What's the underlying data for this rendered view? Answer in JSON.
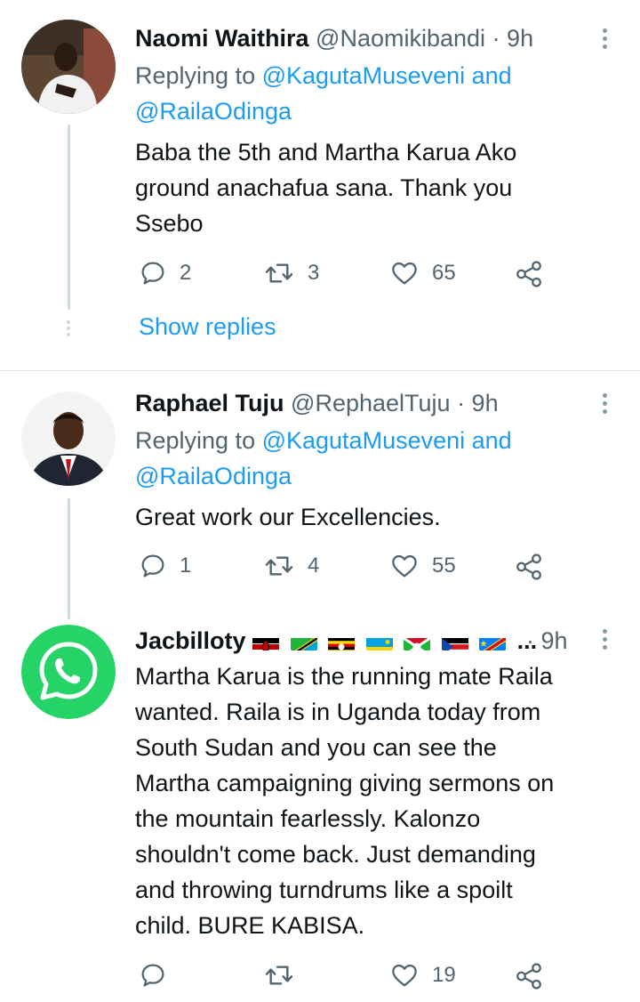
{
  "tweets": [
    {
      "name": "Naomi Waithira",
      "handle": "@Naomikibandi",
      "time": "· 9h",
      "replying_prefix": "Replying to ",
      "replying_user1": "@KagutaMuseveni",
      "replying_and": " and",
      "replying_user2": "@RailaOdinga",
      "body_lines": [
        "Baba the 5th and Martha Karua Ako",
        "ground anachafua sana. Thank you",
        "Ssebo"
      ],
      "replies": "2",
      "retweets": "3",
      "likes": "65",
      "show_replies": "Show replies"
    },
    {
      "name": "Raphael Tuju",
      "handle": "@RephaelTuju",
      "time": "· 9h",
      "replying_prefix": "Replying to ",
      "replying_user1": "@KagutaMuseveni",
      "replying_and": " and",
      "replying_user2": "@RailaOdinga",
      "body_lines": [
        "Great work our Excellencies."
      ],
      "replies": "1",
      "retweets": "4",
      "likes": "55"
    },
    {
      "name": "Jacbilloty",
      "name_suffix": "...",
      "time": "· 9h",
      "flags": [
        "kenya-flag",
        "tanzania-flag",
        "uganda-flag",
        "rwanda-flag",
        "burundi-flag",
        "south-sudan-flag",
        "drc-flag"
      ],
      "body_lines": [
        "Martha Karua is the running mate Raila",
        "wanted. Raila is in Uganda today from",
        "South Sudan and you can see the",
        "Martha campaigning giving sermons on",
        "the mountain fearlessly. Kalonzo",
        "shouldn't come back. Just demanding",
        "and throwing turndrums like a spoilt",
        "child. BURE KABISA."
      ],
      "replies": "",
      "retweets": "",
      "likes": "19"
    }
  ],
  "colors": {
    "link": "#1d9bf0",
    "muted": "#536471",
    "thread_line": "#cfd9de",
    "divider": "#e1e8ed",
    "whatsapp_green": "#25d366"
  }
}
